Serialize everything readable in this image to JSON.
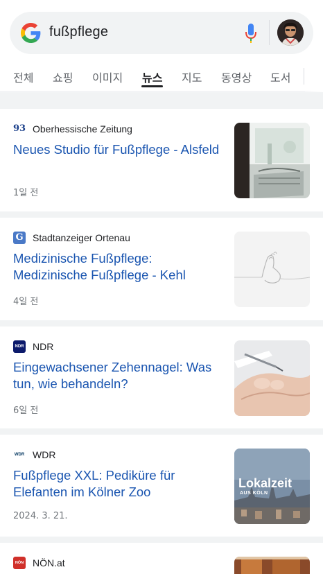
{
  "search": {
    "query": "fußpflege"
  },
  "tabs": [
    {
      "label": "전체",
      "active": false
    },
    {
      "label": "쇼핑",
      "active": false
    },
    {
      "label": "이미지",
      "active": false
    },
    {
      "label": "뉴스",
      "active": true
    },
    {
      "label": "지도",
      "active": false
    },
    {
      "label": "동영상",
      "active": false
    },
    {
      "label": "도서",
      "active": false
    }
  ],
  "results": [
    {
      "source": "Oberhessische Zeitung",
      "source_icon": "oz-icon",
      "source_icon_text": "93",
      "headline": "Neues Studio für Fußpflege - Alsfeld",
      "time": "1일 전",
      "thumbnail": "studio-photo"
    },
    {
      "source": "Stadtanzeiger Ortenau",
      "source_icon": "g-icon",
      "source_icon_text": "G",
      "headline": "Medizinische Fußpflege: Medizinische Fußpflege - Kehl",
      "time": "4일 전",
      "thumbnail": "foot-line-drawing"
    },
    {
      "source": "NDR",
      "source_icon": "ndr-icon",
      "source_icon_text": "NDR",
      "headline": "Eingewachsener Zehennagel: Was tun, wie behandeln?",
      "time": "6일 전",
      "thumbnail": "toenail-photo"
    },
    {
      "source": "WDR",
      "source_icon": "wdr-icon",
      "source_icon_text": "WDR",
      "headline": "Fußpflege XXL: Pediküre für Elefanten im Kölner Zoo",
      "time": "2024. 3. 21.",
      "thumbnail": "lokalzeit-photo",
      "thumbnail_text": "Lokalzeit",
      "thumbnail_subtext": "AUS KÖLN"
    },
    {
      "source": "NÖN.at",
      "source_icon": "noen-icon",
      "source_icon_text": "NÖN",
      "headline": "",
      "time": "",
      "thumbnail": "partial-photo"
    }
  ],
  "colors": {
    "link": "#1a55b0",
    "tab_active": "#202124",
    "background_band": "#f1f3f4"
  }
}
